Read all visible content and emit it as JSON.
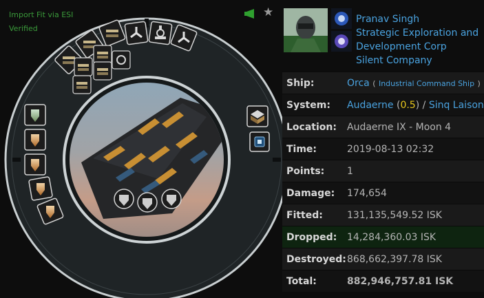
{
  "esi": {
    "import_label": "Import Fit via ESI",
    "status": "Verified"
  },
  "icons": {
    "megaphone": "megaphone-icon",
    "star": "star-icon"
  },
  "victim": {
    "pilot": "Pranav Singh",
    "corp": "Strategic Exploration and Development Corp",
    "alliance": "Silent Company"
  },
  "details": {
    "ship_label": "Ship:",
    "ship_name": "Orca",
    "ship_group_open": "(",
    "ship_group": "Industrial Command Ship",
    "ship_group_close": ")",
    "system_label": "System:",
    "system_name": "Audaerne",
    "system_open": "(",
    "system_sec": "0.5",
    "system_close": ")",
    "system_sep": "/",
    "region": "Sinq Laison",
    "location_label": "Location:",
    "location": "Audaerne IX - Moon 4",
    "time_label": "Time:",
    "time": "2019-08-13 02:32",
    "points_label": "Points:",
    "points": "1",
    "damage_label": "Damage:",
    "damage": "174,654",
    "fitted_label": "Fitted:",
    "fitted": "131,135,549.52 ISK",
    "dropped_label": "Dropped:",
    "dropped": "14,284,360.03 ISK",
    "destroyed_label": "Destroyed:",
    "destroyed": "868,662,397.78 ISK",
    "total_label": "Total:",
    "total": "882,946,757.81 ISK"
  },
  "colors": {
    "link": "#4aa3e0",
    "security": "#e8c81c",
    "destroyed": "#e01818",
    "dropped_bg": "#0e2410",
    "esi_green": "#3a9a3a"
  }
}
